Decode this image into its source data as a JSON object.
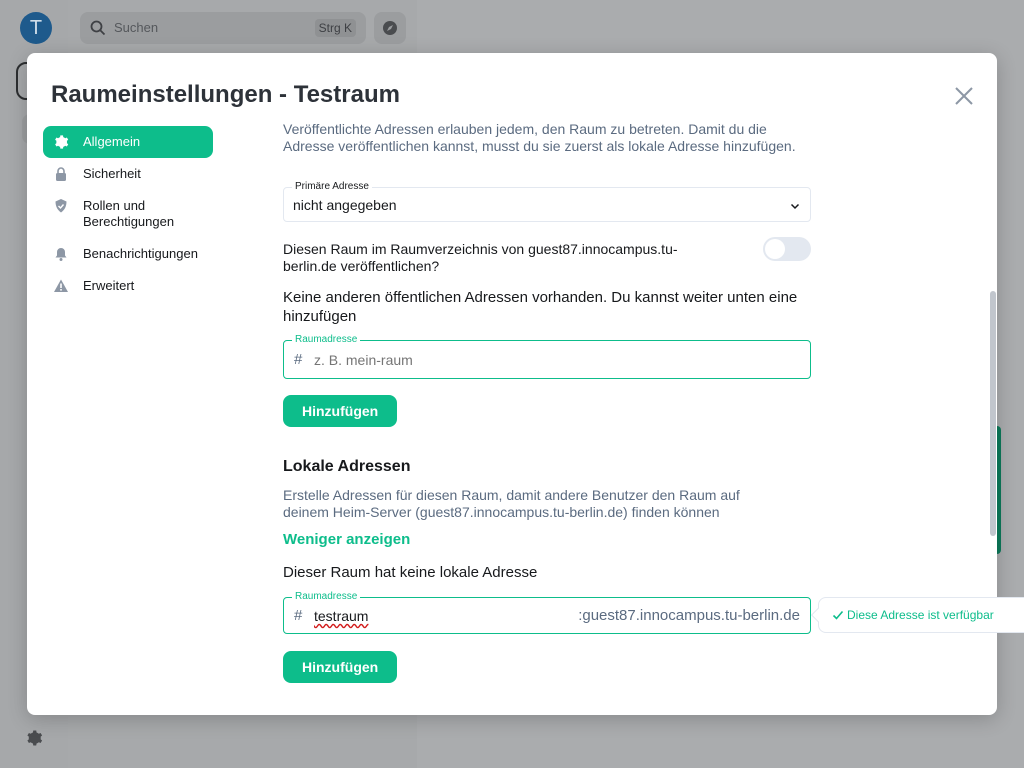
{
  "background": {
    "avatar_initial": "T",
    "search_placeholder": "Suchen",
    "search_shortcut": "Strg K",
    "settings_icon": "gear-icon"
  },
  "dialog": {
    "title": "Raumeinstellungen - Testraum",
    "close_icon": "close-icon",
    "tabs": [
      {
        "label": "Allgemein",
        "icon": "gear-icon",
        "active": true
      },
      {
        "label": "Sicherheit",
        "icon": "lock-icon",
        "active": false
      },
      {
        "label": "Rollen und Berechtigungen",
        "icon": "shield-check-icon",
        "active": false
      },
      {
        "label": "Benachrichtigungen",
        "icon": "bell-icon",
        "active": false
      },
      {
        "label": "Erweitert",
        "icon": "warning-icon",
        "active": false
      }
    ]
  },
  "published": {
    "description": "Veröffentlichte Adressen erlauben jedem, den Raum zu betreten. Damit du die Adresse veröffentlichen kannst, musst du sie zuerst als lokale Adresse hinzufügen.",
    "primary_label": "Primäre Adresse",
    "primary_value": "nicht angegeben",
    "directory_text": "Diesen Raum im Raumverzeichnis von guest87.innocampus.tu-berlin.de veröffentlichen?",
    "directory_toggle_on": false,
    "no_addresses_text": "Keine anderen öffentlichen Adressen vorhanden. Du kannst weiter unten eine hinzufügen",
    "address_label": "Raumadresse",
    "address_prefix": "#",
    "address_placeholder": "z. B. mein-raum",
    "add_button": "Hinzufügen"
  },
  "local": {
    "heading": "Lokale Adressen",
    "description": "Erstelle Adressen für diesen Raum, damit andere Benutzer den Raum auf deinem Heim-Server (guest87.innocampus.tu-berlin.de) finden können",
    "toggle_link": "Weniger anzeigen",
    "none_text": "Dieser Raum hat keine lokale Adresse",
    "address_label": "Raumadresse",
    "address_prefix": "#",
    "address_value": "testraum",
    "address_suffix": ":guest87.innocampus.tu-berlin.de",
    "add_button": "Hinzufügen",
    "tooltip": "Diese Adresse ist verfügbar"
  },
  "colors": {
    "accent": "#0dbd8b",
    "secondary_text": "#5b6b80",
    "border": "#e3e8f0"
  }
}
